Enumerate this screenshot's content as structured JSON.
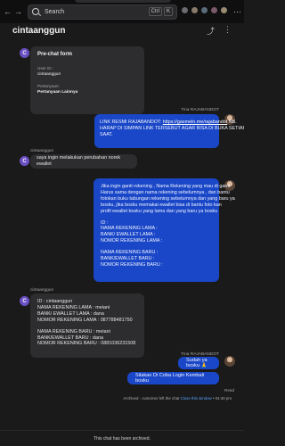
{
  "topbar": {
    "search_placeholder": "Search",
    "shortcut_keys": [
      "Ctrl",
      "K"
    ],
    "more_icon": "⋯"
  },
  "header": {
    "title": "cintaanggun"
  },
  "messages": {
    "form": {
      "title": "Pre-chat form",
      "user_id_label": "User ID :",
      "user_id_value": "cintaanggun",
      "question_label": "Pertanyaan:",
      "question_value": "Pertanyaan Lainnya"
    },
    "agent_name_1": "Tina RAJABANDOT",
    "agent_msg_1": [
      "LINK RESMI RAJABANDOT: ",
      "https://gasmeln.me/rajabandot",
      " NB.",
      "HARAP DI SIMPAN LINK TERSEBUT AGAR BISA DI BUKA SETIAP",
      "SAAT."
    ],
    "customer_name_1": "cintaanggun",
    "customer_msg_1": "saya ingin melakukan perubahan norek ewallet",
    "agent_msg_2": [
      "Jika ingin ganti rekening , Nama Rekening yang mau di ganti",
      "Harus sama dengan nama rekening sebelumnya , dan bantu",
      "fotokan buku tabungan rekening sebelumnya dan yang baru ya",
      "bosku, jika bosku memakai ewallet bisa di bantu foto kan",
      "profil ewallet bosku yang lama dan yang baru ya bosku",
      "",
      "ID :",
      "NAMA REKENING LAMA :",
      "BANK/ EWALLET LAMA :",
      "NOMOR REKENING LAMA :",
      "",
      "NAMA REKENING BARU :",
      "BANK/EWALLET BARU :",
      "NOMOR REKENING BARU :"
    ],
    "customer_name_2": "cintaanggun",
    "customer_msg_2": [
      "ID : cintaanggun",
      "NAMA REKENING LAMA : meiani",
      "BANK/ EWALLET LAMA : dana",
      "NOMOR REKENING LAMA : 087788481750",
      "",
      "NAMA REKENING BARU : meiani",
      "BANK/EWALLET BARU : dana",
      "NOMOR REKENING BARU : 0881036231508"
    ],
    "agent_name_3": "Tina RAJABANDOT",
    "agent_msg_3": "Sudah ya bosku 🙏",
    "agent_msg_4": "Silakan Di Coba Login Kembali bosku",
    "read_status": "Read",
    "archive_text": "Archived - customer left the chat ",
    "archive_link": "Close this window",
    "archive_time": " • 04:40 pm"
  },
  "footer": {
    "text": "This chat has been archived."
  }
}
